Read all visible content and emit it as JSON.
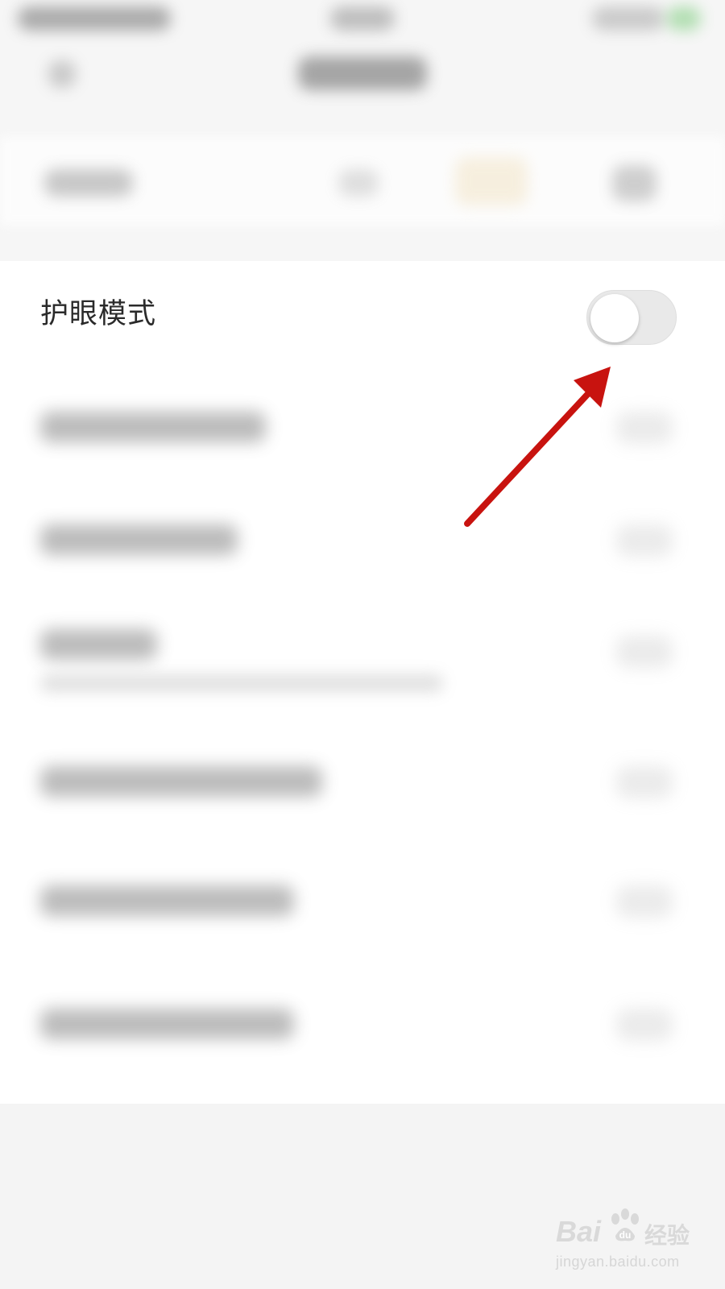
{
  "settings": {
    "eye_mode": {
      "label": "护眼模式",
      "enabled": false
    }
  },
  "annotation": {
    "arrow_color": "#c8130f"
  },
  "watermark": {
    "brand": "Bai",
    "brand_cn": "经验",
    "url": "jingyan.baidu.com"
  }
}
